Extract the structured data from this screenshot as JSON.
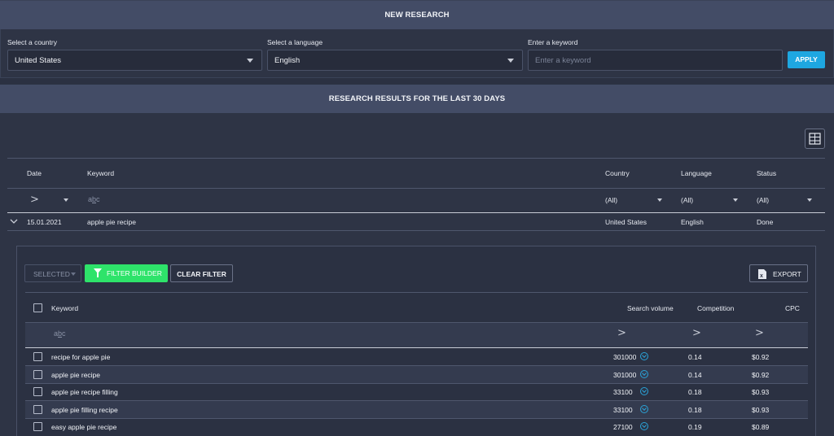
{
  "new_research": {
    "title": "NEW RESEARCH",
    "country_label": "Select a country",
    "country_value": "United States",
    "language_label": "Select a language",
    "language_value": "English",
    "keyword_label": "Enter a keyword",
    "keyword_placeholder": "Enter a keyword",
    "apply_label": "APPLY"
  },
  "results": {
    "title": "RESEARCH RESULTS FOR THE LAST 30 DAYS",
    "columns": {
      "date": "Date",
      "keyword": "Keyword",
      "country": "Country",
      "language": "Language",
      "status": "Status"
    },
    "filters": {
      "date_op": ">",
      "country": "(All)",
      "language": "(All)",
      "status": "(All)"
    },
    "row": {
      "date": "15.01.2021",
      "keyword": "apple pie recipe",
      "country": "United States",
      "language": "English",
      "status": "Done"
    }
  },
  "detail": {
    "selected_label": "SELECTED",
    "filter_builder_label": "FILTER BUILDER",
    "clear_filter_label": "CLEAR FILTER",
    "export_label": "EXPORT",
    "columns": {
      "keyword": "Keyword",
      "search_volume": "Search volume",
      "competition": "Competition",
      "cpc": "CPC"
    },
    "filter_ops": {
      "search_volume": ">",
      "competition": ">",
      "cpc": ">"
    },
    "rows": [
      {
        "keyword": "recipe for apple pie",
        "volume": "301000",
        "competition": "0.14",
        "cpc": "$0.92"
      },
      {
        "keyword": "apple pie recipe",
        "volume": "301000",
        "competition": "0.14",
        "cpc": "$0.92"
      },
      {
        "keyword": "apple pie recipe filling",
        "volume": "33100",
        "competition": "0.18",
        "cpc": "$0.93"
      },
      {
        "keyword": "apple pie filling recipe",
        "volume": "33100",
        "competition": "0.18",
        "cpc": "$0.93"
      },
      {
        "keyword": "easy apple pie recipe",
        "volume": "27100",
        "competition": "0.19",
        "cpc": "$0.89"
      }
    ]
  },
  "colors": {
    "accent": "#1ea7e1",
    "filter_builder": "#2ee36a",
    "header_bg": "#434c66"
  },
  "icons": {
    "grid": "column-chooser-icon",
    "funnel": "funnel-icon",
    "export": "excel-icon",
    "text_search": "text-search-icon"
  }
}
